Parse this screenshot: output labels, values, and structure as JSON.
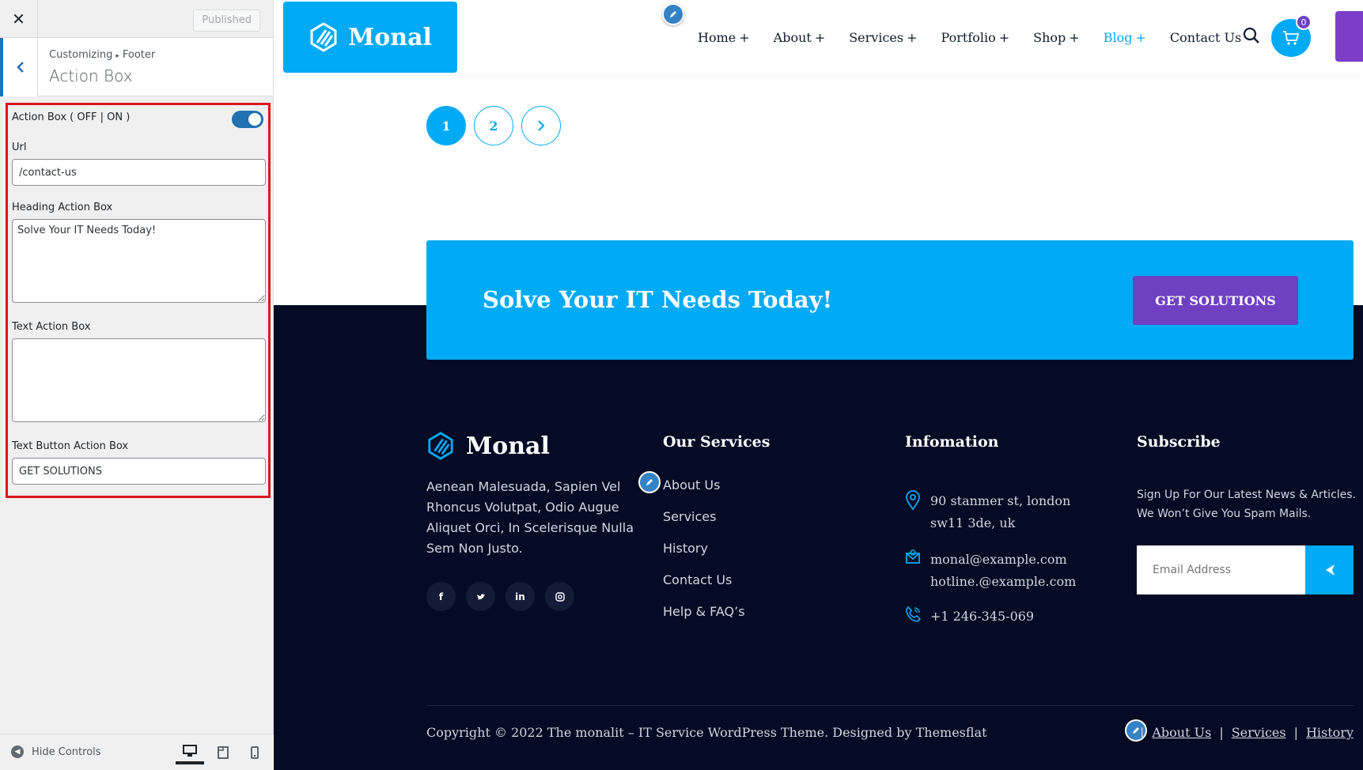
{
  "customizer": {
    "close_label": "✕",
    "published_label": "Published",
    "breadcrumb_root": "Customizing",
    "breadcrumb_arrow": "▸",
    "breadcrumb_section": "Footer",
    "section_title": "Action Box",
    "toggle_label": "Action Box ( OFF | ON )",
    "toggle_on": true,
    "url_label": "Url",
    "url_value": "/contact-us",
    "heading_label": "Heading Action Box",
    "heading_value": "Solve Your IT Needs Today!",
    "text_label": "Text Action Box",
    "text_value": "",
    "button_text_label": "Text Button Action Box",
    "button_text_value": "GET SOLUTIONS",
    "hide_controls": "Hide Controls"
  },
  "site": {
    "logo": "Monal",
    "nav": [
      {
        "label": "Home",
        "plus": "+"
      },
      {
        "label": "About",
        "plus": "+"
      },
      {
        "label": "Services",
        "plus": "+"
      },
      {
        "label": "Portfolio",
        "plus": "+"
      },
      {
        "label": "Shop",
        "plus": "+"
      },
      {
        "label": "Blog",
        "plus": "+"
      },
      {
        "label": "Contact Us",
        "plus": ""
      }
    ],
    "cart_count": "0",
    "pagination": [
      "1",
      "2",
      "›"
    ],
    "action_box": {
      "heading": "Solve Your IT Needs Today!",
      "button": "GET SOLUTIONS"
    },
    "footer": {
      "logo": "Monal",
      "about": "Aenean Malesuada, Sapien Vel Rhoncus Volutpat, Odio Augue Aliquet Orci, In Scelerisque Nulla Sem Non Justo.",
      "socials": [
        "f",
        "t",
        "in",
        "ig"
      ],
      "services_heading": "Our Services",
      "services": [
        "About Us",
        "Services",
        "History",
        "Contact Us",
        "Help & FAQ’s"
      ],
      "info_heading": "Infomation",
      "address_line1": "90 stanmer st, london",
      "address_line2": "sw11 3de, uk",
      "email1": "monal@example.com",
      "email2": "hotline.@example.com",
      "phone": "+1 246-345-069",
      "subscribe_heading": "Subscribe",
      "subscribe_line1": "Sign Up For Our Latest News & Articles.",
      "subscribe_line2": "We Won’t Give You Spam Mails.",
      "email_placeholder": "Email Address",
      "copyright": "Copyright © 2022 The monalit – IT Service WordPress Theme. Designed by Themesflat",
      "bottom_links": [
        "About Us",
        "Services",
        "History"
      ],
      "bottom_sep": "|"
    }
  },
  "colors": {
    "accent": "#00aaf5",
    "purple": "#7040c2",
    "footer_bg": "#050b24",
    "wp_blue": "#2271b1"
  }
}
